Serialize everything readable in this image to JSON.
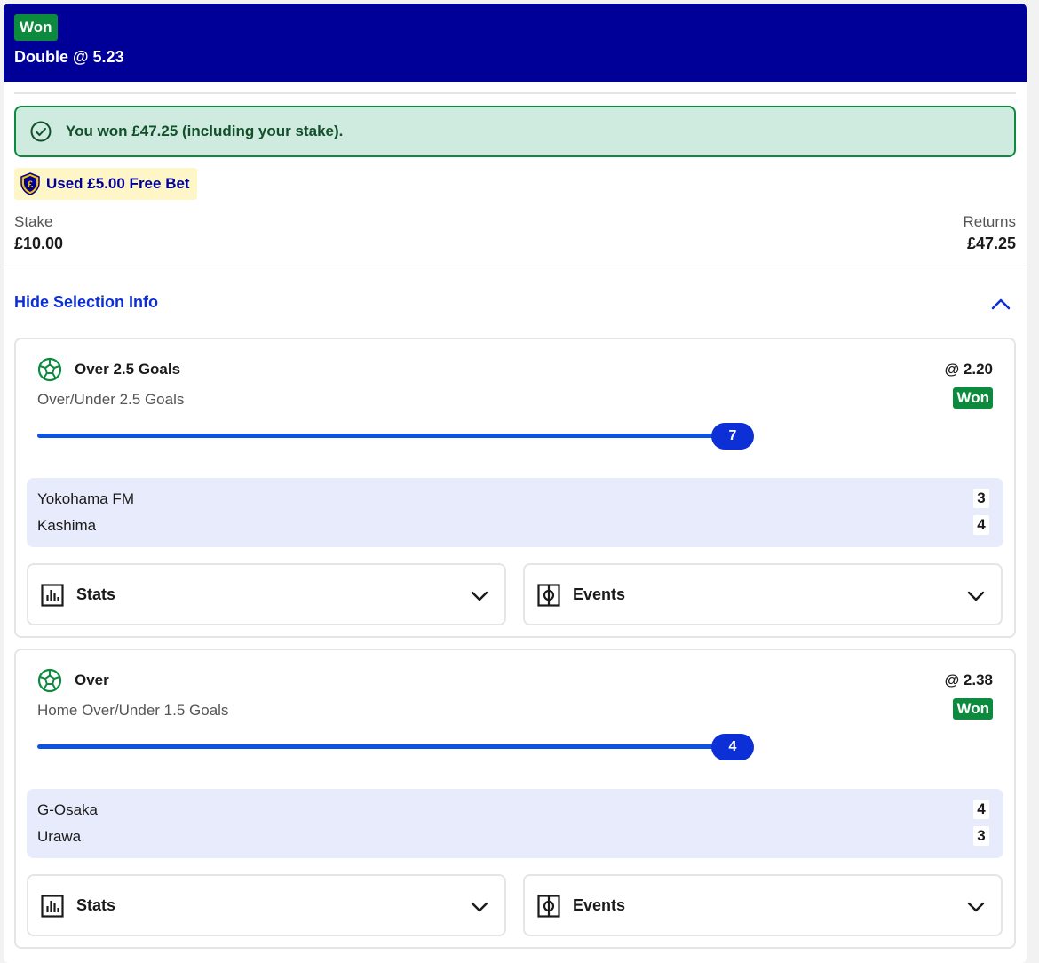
{
  "header": {
    "status": "Won",
    "title": "Double @ 5.23"
  },
  "banner": {
    "message": "You won £47.25 (including your stake)."
  },
  "freebet": {
    "label": "Used £5.00 Free Bet"
  },
  "summary": {
    "stake_label": "Stake",
    "stake_value": "£10.00",
    "returns_label": "Returns",
    "returns_value": "£47.25"
  },
  "toggle": {
    "label": "Hide Selection Info"
  },
  "selections": [
    {
      "name": "Over 2.5 Goals",
      "odds": "@ 2.20",
      "market": "Over/Under 2.5 Goals",
      "status": "Won",
      "progress_value": "7",
      "teams": [
        {
          "name": "Yokohama FM",
          "score": "3"
        },
        {
          "name": "Kashima",
          "score": "4"
        }
      ],
      "stats_label": "Stats",
      "events_label": "Events"
    },
    {
      "name": "Over",
      "odds": "@ 2.38",
      "market": "Home Over/Under 1.5 Goals",
      "status": "Won",
      "progress_value": "4",
      "teams": [
        {
          "name": "G-Osaka",
          "score": "4"
        },
        {
          "name": "Urawa",
          "score": "3"
        }
      ],
      "stats_label": "Stats",
      "events_label": "Events"
    }
  ],
  "colors": {
    "header_bg": "#000098",
    "won_green": "#0c8a3e",
    "link_blue": "#0d2fd6",
    "score_bg": "#e8ebfb"
  }
}
